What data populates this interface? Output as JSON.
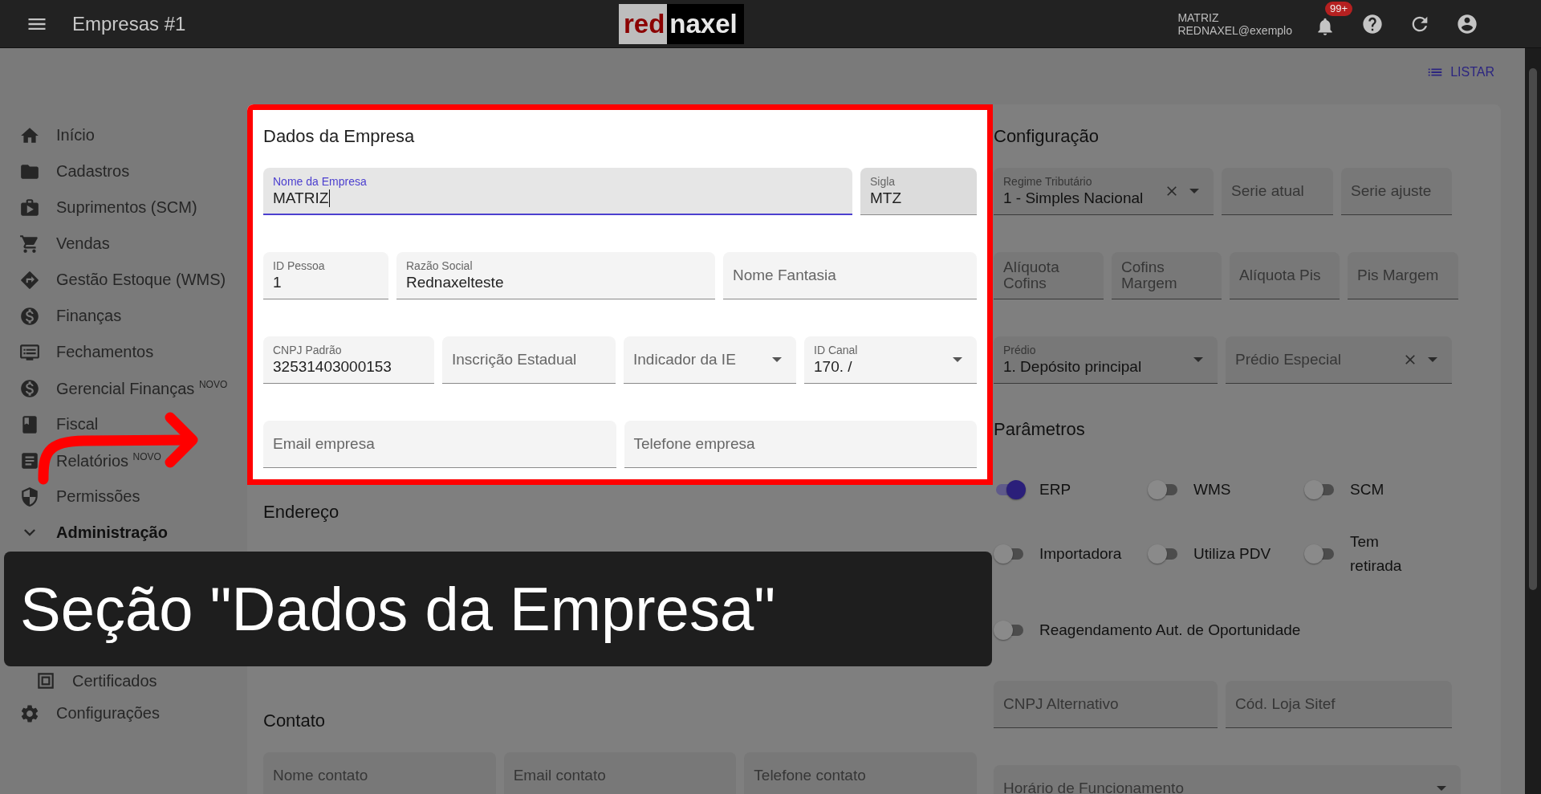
{
  "app_bar": {
    "title": "Empresas #1",
    "logo": {
      "part_1": "red",
      "part_2": "naxel"
    },
    "user_name": "MATRIZ",
    "user_email": "REDNAXEL@exemplo",
    "notification_count": "99+"
  },
  "toolbar": {
    "list_button": "LISTAR"
  },
  "sidebar": {
    "items": [
      {
        "label": "Início",
        "selected": false
      },
      {
        "label": "Cadastros",
        "selected": false
      },
      {
        "label": "Suprimentos (SCM)",
        "selected": false
      },
      {
        "label": "Vendas",
        "selected": false
      },
      {
        "label": "Gestão Estoque (WMS)",
        "selected": false
      },
      {
        "label": "Finanças",
        "selected": false
      },
      {
        "label": "Fechamentos",
        "selected": false
      },
      {
        "label": "Gerencial Finanças $^{NOVO}$",
        "selected": false
      },
      {
        "label": "Fiscal",
        "selected": false
      },
      {
        "label": "Relatórios $^{NOVO}$",
        "selected": false
      },
      {
        "label": "Permissões",
        "selected": false
      },
      {
        "label": "Administração",
        "selected": false,
        "expanded": true,
        "children": [
          {
            "label": "Certificados",
            "selected": false
          }
        ]
      },
      {
        "label": "Configurações",
        "selected": false
      }
    ]
  },
  "sections": [
    {
      "title": "Dados da Empresa",
      "highlighted": true,
      "rows": [
        {
          "fields": [
            {
              "kind": "text",
              "label": "Nome da Empresa",
              "value": "MATRIZ",
              "focused": true
            },
            {
              "kind": "text",
              "label": "Sigla",
              "value": "MTZ",
              "hovered": true
            }
          ]
        },
        {
          "fields": [
            {
              "kind": "text",
              "label": "ID Pessoa",
              "value": "1"
            },
            {
              "kind": "text",
              "label": "Razão Social",
              "value": "Rednaxelteste"
            },
            {
              "kind": "text",
              "label": "Nome Fantasia"
            }
          ]
        },
        {
          "fields": [
            {
              "kind": "text",
              "label": "CNPJ Padrão",
              "value": "32531403000153"
            },
            {
              "kind": "text",
              "label": "Inscrição Estadual"
            },
            {
              "kind": "select",
              "label": "Indicador da IE"
            },
            {
              "kind": "select",
              "label": "ID Canal",
              "value": "170. /"
            }
          ]
        },
        {
          "fields": [
            {
              "kind": "text",
              "label": "Email empresa"
            },
            {
              "kind": "text",
              "label": "Telefone empresa"
            }
          ]
        }
      ]
    },
    {
      "title": "Endereço",
      "highlighted": false
    },
    {
      "title": "Contato",
      "highlighted": false,
      "rows": [
        {
          "fields": [
            {
              "kind": "text",
              "label": "Nome contato"
            },
            {
              "kind": "text",
              "label": "Email contato"
            },
            {
              "kind": "text",
              "label": "Telefone contato"
            }
          ]
        }
      ]
    }
  ],
  "side_sections": [
    {
      "title": "Configuração",
      "highlighted": false,
      "rows": [
        {
          "fields": [
            {
              "kind": "select_clearable",
              "label": "Regime Tributário",
              "value": "1 - Simples Nacional"
            },
            {
              "kind": "text",
              "label": "Serie atual"
            },
            {
              "kind": "text",
              "label": "Serie ajuste"
            }
          ]
        },
        {
          "fields": [
            {
              "kind": "text",
              "label": "Alíquota Cofins"
            },
            {
              "kind": "text",
              "label": "Cofins Margem"
            },
            {
              "kind": "text",
              "label": "Alíquota Pis"
            },
            {
              "kind": "text",
              "label": "Pis Margem"
            }
          ]
        },
        {
          "fields": [
            {
              "kind": "select",
              "label": "Prédio",
              "value": "1. Depósito principal"
            },
            {
              "kind": "select_clearable",
              "label": "Prédio Especial"
            }
          ]
        }
      ]
    },
    {
      "title": "Parâmetros",
      "highlighted": false,
      "switches": [
        {
          "label": "ERP",
          "on": true
        },
        {
          "label": "WMS",
          "on": false
        },
        {
          "label": "SCM",
          "on": false
        },
        {
          "label": "Importadora",
          "on": false
        },
        {
          "label": "Utiliza PDV",
          "on": false
        },
        {
          "label": "Tem retirada",
          "on": false
        },
        {
          "label": "Reagendamento Aut. de Oportunidade",
          "on": false
        }
      ],
      "rows": [
        {
          "fields": [
            {
              "kind": "text",
              "label": "CNPJ Alternativo"
            },
            {
              "kind": "text",
              "label": "Cód. Loja Sitef"
            }
          ]
        },
        {
          "fields": [
            {
              "kind": "select",
              "label": "Horário de Funcionamento"
            }
          ]
        }
      ]
    }
  ],
  "caption": "Seção \"Dados da Empresa\""
}
